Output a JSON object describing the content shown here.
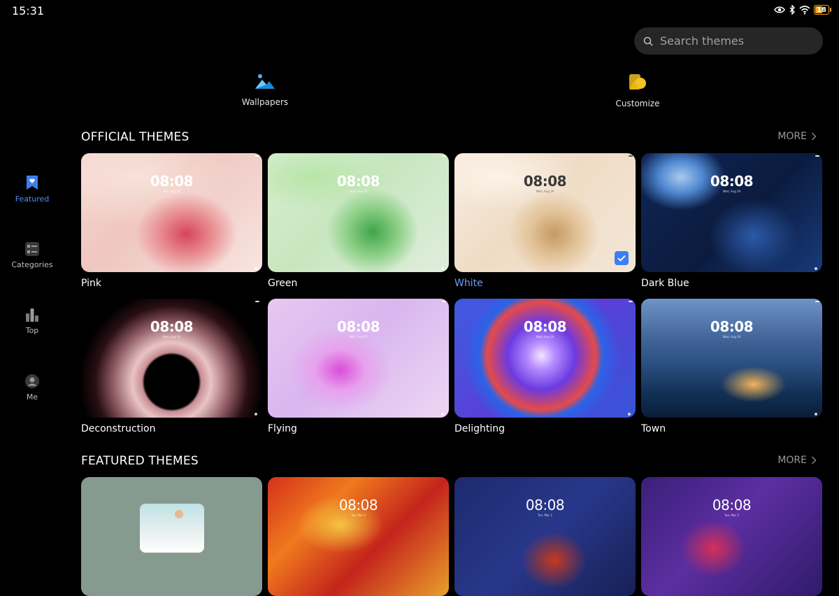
{
  "status_bar": {
    "time": "15:31",
    "battery": "18"
  },
  "search": {
    "placeholder": "Search themes"
  },
  "shortcuts": [
    {
      "label": "Wallpapers",
      "icon": "wallpapers-icon"
    },
    {
      "label": "Customize",
      "icon": "customize-icon"
    }
  ],
  "nav": [
    {
      "label": "Featured",
      "icon": "featured-icon",
      "active": true
    },
    {
      "label": "Categories",
      "icon": "categories-icon",
      "active": false
    },
    {
      "label": "Top",
      "icon": "top-chart-icon",
      "active": false
    },
    {
      "label": "Me",
      "icon": "profile-icon",
      "active": false
    }
  ],
  "official": {
    "title": "OFFICIAL THEMES",
    "more": "MORE",
    "themes": [
      {
        "name": "Pink",
        "clock": "08:08",
        "date": "Wed, Aug 19"
      },
      {
        "name": "Green",
        "clock": "08:08",
        "date": "Wed, Aug 19"
      },
      {
        "name": "White",
        "clock": "08:08",
        "date": "Wed, Aug 19",
        "selected": true
      },
      {
        "name": "Dark Blue",
        "clock": "08:08",
        "date": "Wed, Aug 19"
      },
      {
        "name": "Deconstruction",
        "clock": "08:08",
        "date": "Wed, Aug 19"
      },
      {
        "name": "Flying",
        "clock": "08:08",
        "date": "Wed, Aug 19"
      },
      {
        "name": "Delighting",
        "clock": "08:08",
        "date": "Wed, Aug 19"
      },
      {
        "name": "Town",
        "clock": "08:08",
        "date": "Wed, Aug 19"
      }
    ]
  },
  "featured": {
    "title": "FEATURED THEMES",
    "more": "MORE",
    "themes": [
      {
        "clock": ""
      },
      {
        "clock": "08:08",
        "date": "Tue, Mar 2"
      },
      {
        "clock": "08:08",
        "date": "Tue, Mar 2"
      },
      {
        "clock": "08:08",
        "date": "Tue, Mar 2"
      }
    ]
  },
  "colors": {
    "accent": "#4d8df5",
    "selected_text": "#6e9cf5",
    "background": "#000000",
    "search_bg": "#262626"
  }
}
